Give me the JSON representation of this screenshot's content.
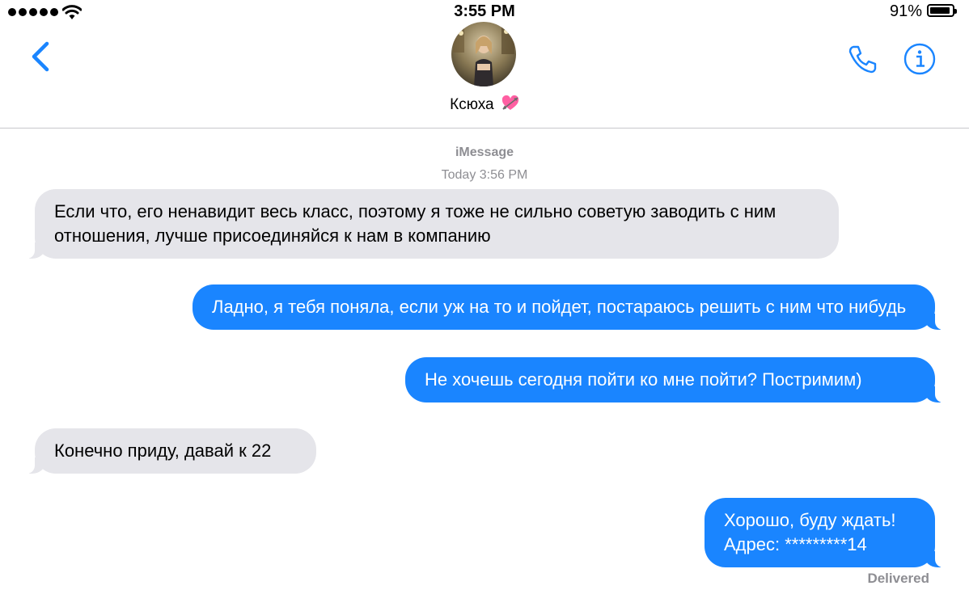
{
  "status_bar": {
    "time": "3:55 PM",
    "battery_percent": "91%",
    "battery_level": 0.91,
    "signal_bars": 5,
    "icons": [
      "signal-dots-icon",
      "wifi-icon",
      "battery-icon"
    ]
  },
  "header": {
    "contact_name": "Ксюха",
    "icons": [
      "back-chevron-icon",
      "heart-with-arrow-icon",
      "phone-icon",
      "info-icon"
    ],
    "accent_color": "#1a85ff"
  },
  "conversation": {
    "service": "iMessage",
    "timestamp": "Today 3:56 PM",
    "messages": [
      {
        "direction": "incoming",
        "text": "Если что, его ненавидит весь класс, поэтому я тоже не сильно советую заводить с ним отношения, лучше присоединяйся к нам в компанию"
      },
      {
        "direction": "outgoing",
        "text": "Ладно, я тебя поняла, если уж на то и пойдет, постараюсь решить с ним что нибудь"
      },
      {
        "direction": "outgoing",
        "text": "Не хочешь сегодня пойти ко мне пойти? Постримим)"
      },
      {
        "direction": "incoming",
        "text": "Конечно приду, давай к 22"
      },
      {
        "direction": "outgoing",
        "text": "Хорошо, буду ждать! Адрес: *********14"
      }
    ],
    "delivery_status": "Delivered",
    "colors": {
      "incoming_bubble": "#e5e5ea",
      "outgoing_bubble": "#1a85ff",
      "meta_text": "#8e8e93"
    }
  }
}
